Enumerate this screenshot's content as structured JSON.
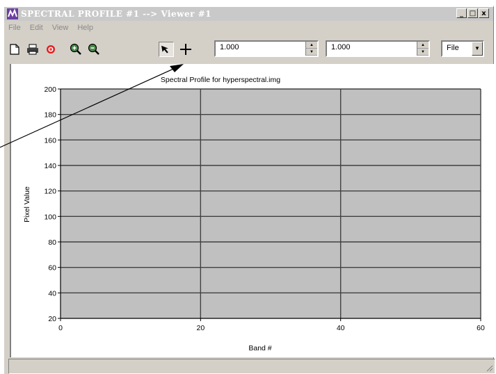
{
  "window": {
    "title": "SPECTRAL PROFILE #1 --> Viewer #1",
    "controls": {
      "minimize": "_",
      "maximize": "□",
      "close": "x"
    }
  },
  "menu": [
    {
      "label": "File"
    },
    {
      "label": "Edit"
    },
    {
      "label": "View"
    },
    {
      "label": "Help"
    }
  ],
  "toolbar": {
    "icons": [
      "new-document-icon",
      "printer-icon",
      "color-wheel-icon",
      "zoom-in-icon",
      "zoom-out-icon",
      "arrow-pointer-icon",
      "crosshair-icon"
    ],
    "spin1_value": "1.000",
    "spin2_value": "1.000",
    "combo_value": "File"
  },
  "chart_data": {
    "type": "line",
    "title": "Spectral Profile for hyperspectral.img",
    "xlabel": "Band #",
    "ylabel": "Pixel Value",
    "xlim": [
      0,
      60
    ],
    "ylim": [
      20,
      200
    ],
    "xticks": [
      0,
      20,
      40,
      60
    ],
    "yticks": [
      20,
      40,
      60,
      80,
      100,
      120,
      140,
      160,
      180,
      200
    ],
    "grid": true,
    "plot_background": "#c0c0c0",
    "series": []
  },
  "colors": {
    "plot_bg": "#c0c0c0",
    "grid": "#404040",
    "annotation": "#000000"
  }
}
